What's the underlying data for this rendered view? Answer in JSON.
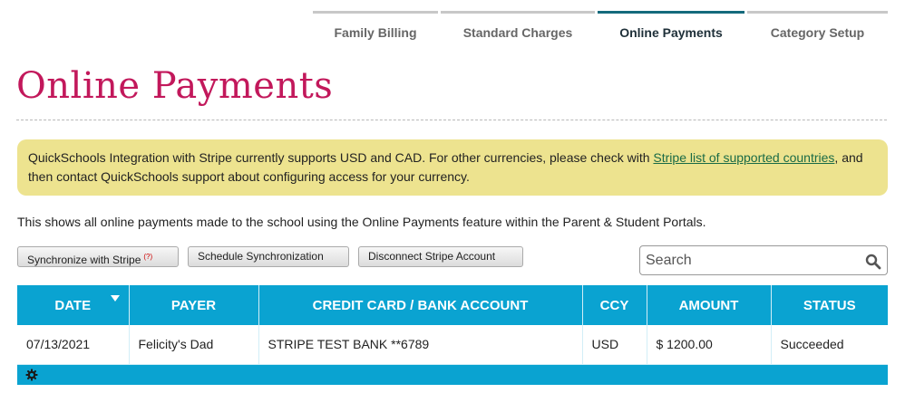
{
  "tabs": [
    {
      "label": "Family Billing",
      "active": false
    },
    {
      "label": "Standard Charges",
      "active": false
    },
    {
      "label": "Online Payments",
      "active": true
    },
    {
      "label": "Category Setup",
      "active": false
    }
  ],
  "page_title": "Online Payments",
  "notice": {
    "text_before": "QuickSchools Integration with Stripe currently supports USD and CAD. For other currencies, please check with ",
    "link_text": "Stripe list of supported countries",
    "text_after": ", and then contact QuickSchools support about configuring access for your currency.",
    "background": "#ede38f"
  },
  "description": "This shows all online payments made to the school using the Online Payments feature within the Parent & Student Portals.",
  "buttons": {
    "synchronize": "Synchronize with Stripe",
    "synchronize_help": "(?)",
    "schedule": "Schedule Synchronization",
    "disconnect": "Disconnect Stripe Account"
  },
  "search": {
    "placeholder": "Search",
    "value": ""
  },
  "table": {
    "columns": [
      "DATE",
      "PAYER",
      "CREDIT CARD / BANK ACCOUNT",
      "CCY",
      "AMOUNT",
      "STATUS"
    ],
    "rows": [
      [
        "07/13/2021",
        "Felicity's Dad",
        "STRIPE TEST BANK **6789",
        "USD",
        "$ 1200.00",
        "Succeeded"
      ]
    ]
  },
  "colors": {
    "accent": "#0aa3d1",
    "title": "#c2185b",
    "active_tab": "#146a7c"
  },
  "icons": {
    "sort": "caret-down-icon",
    "search": "search-icon",
    "settings": "gear-icon"
  }
}
